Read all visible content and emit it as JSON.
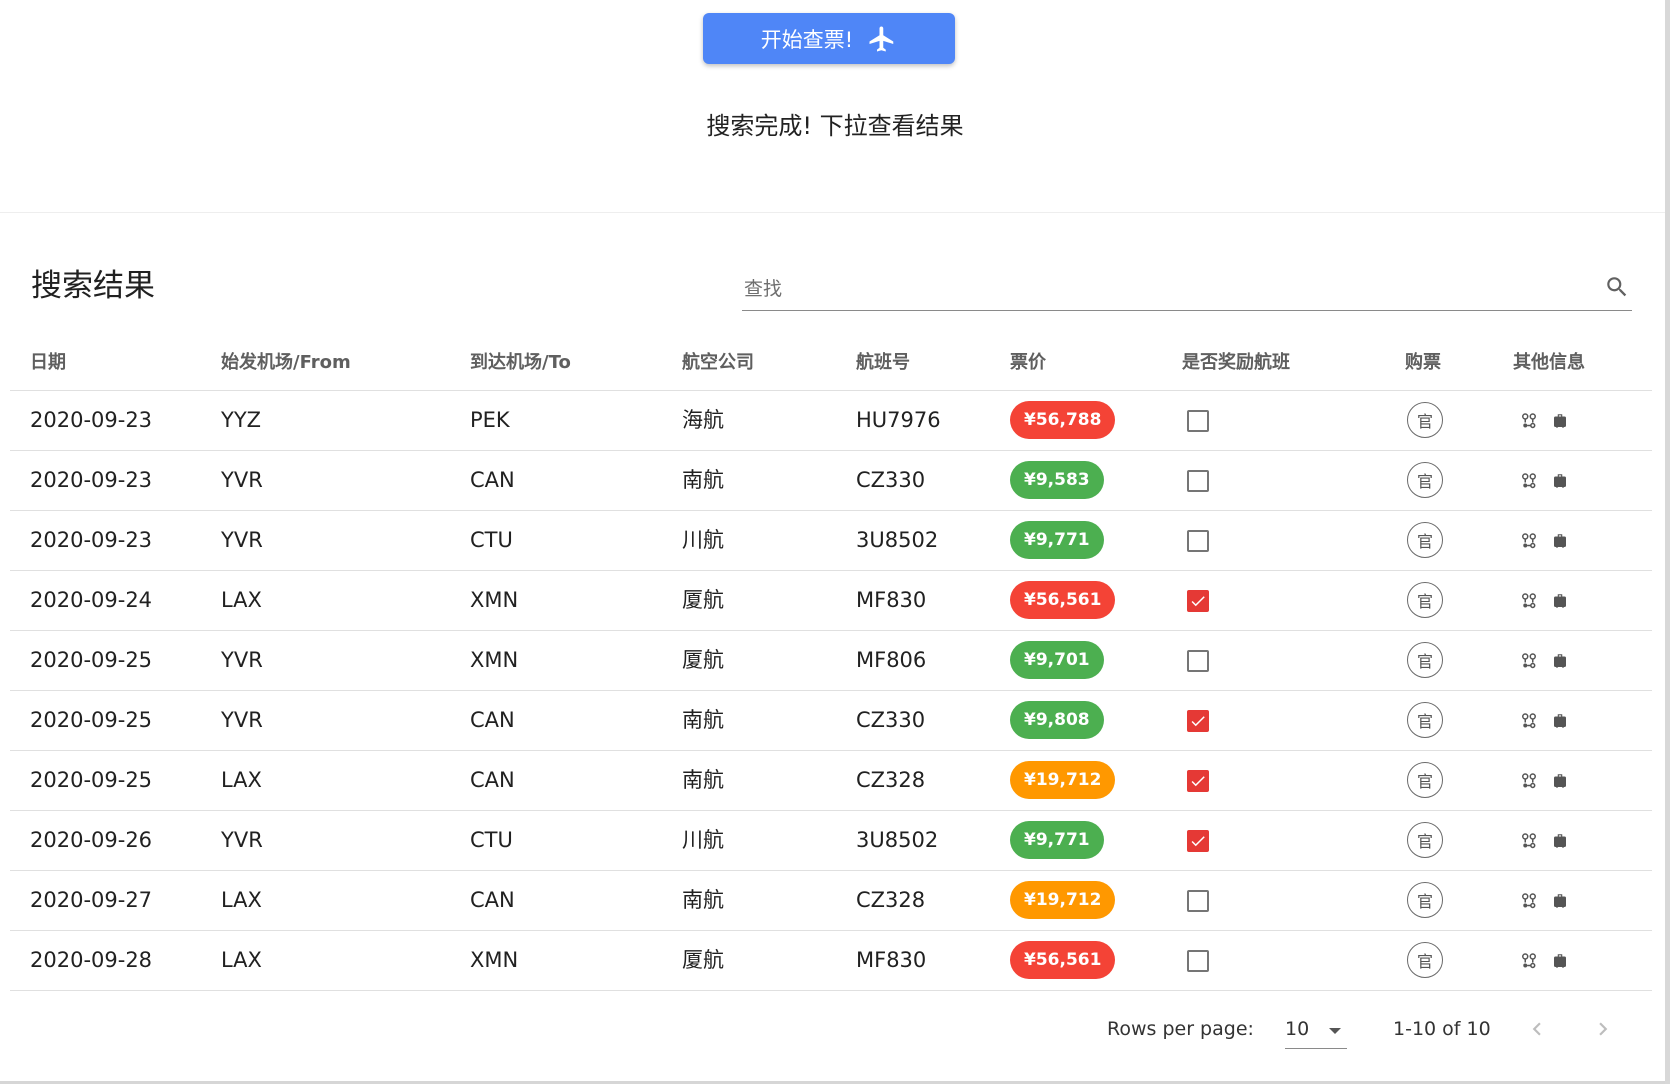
{
  "top": {
    "start_button_label": "开始查票!",
    "status_message": "搜索完成! 下拉查看结果"
  },
  "results": {
    "title": "搜索结果",
    "search_placeholder": "查找"
  },
  "columns": [
    "日期",
    "始发机场/From",
    "到达机场/To",
    "航空公司",
    "航班号",
    "票价",
    "是否奖励航班",
    "购票",
    "其他信息"
  ],
  "rows": [
    {
      "date": "2020-09-23",
      "from": "YYZ",
      "to": "PEK",
      "airline": "海航",
      "flight": "HU7976",
      "price": "¥56,788",
      "price_level": "high",
      "reward": false,
      "buy_label": "官"
    },
    {
      "date": "2020-09-23",
      "from": "YVR",
      "to": "CAN",
      "airline": "南航",
      "flight": "CZ330",
      "price": "¥9,583",
      "price_level": "low",
      "reward": false,
      "buy_label": "官"
    },
    {
      "date": "2020-09-23",
      "from": "YVR",
      "to": "CTU",
      "airline": "川航",
      "flight": "3U8502",
      "price": "¥9,771",
      "price_level": "low",
      "reward": false,
      "buy_label": "官"
    },
    {
      "date": "2020-09-24",
      "from": "LAX",
      "to": "XMN",
      "airline": "厦航",
      "flight": "MF830",
      "price": "¥56,561",
      "price_level": "high",
      "reward": true,
      "buy_label": "官"
    },
    {
      "date": "2020-09-25",
      "from": "YVR",
      "to": "XMN",
      "airline": "厦航",
      "flight": "MF806",
      "price": "¥9,701",
      "price_level": "low",
      "reward": false,
      "buy_label": "官"
    },
    {
      "date": "2020-09-25",
      "from": "YVR",
      "to": "CAN",
      "airline": "南航",
      "flight": "CZ330",
      "price": "¥9,808",
      "price_level": "low",
      "reward": true,
      "buy_label": "官"
    },
    {
      "date": "2020-09-25",
      "from": "LAX",
      "to": "CAN",
      "airline": "南航",
      "flight": "CZ328",
      "price": "¥19,712",
      "price_level": "mid",
      "reward": true,
      "buy_label": "官"
    },
    {
      "date": "2020-09-26",
      "from": "YVR",
      "to": "CTU",
      "airline": "川航",
      "flight": "3U8502",
      "price": "¥9,771",
      "price_level": "low",
      "reward": true,
      "buy_label": "官"
    },
    {
      "date": "2020-09-27",
      "from": "LAX",
      "to": "CAN",
      "airline": "南航",
      "flight": "CZ328",
      "price": "¥19,712",
      "price_level": "mid",
      "reward": false,
      "buy_label": "官"
    },
    {
      "date": "2020-09-28",
      "from": "LAX",
      "to": "XMN",
      "airline": "厦航",
      "flight": "MF830",
      "price": "¥56,561",
      "price_level": "high",
      "reward": false,
      "buy_label": "官"
    }
  ],
  "price_colors": {
    "high": "#f44336",
    "mid": "#ff9800",
    "low": "#4caf50"
  },
  "icons": {
    "start_button": "airplane-icon",
    "search": "search-icon",
    "info": [
      "route-pins-icon",
      "luggage-icon"
    ],
    "prev": "chevron-left-icon",
    "next": "chevron-right-icon",
    "dropdown": "caret-down-icon"
  },
  "pagination": {
    "rows_per_page_label": "Rows per page:",
    "rows_per_page_value": "10",
    "range_text": "1-10 of 10"
  },
  "colors": {
    "accent": "#4f86f7",
    "reward_checked": "#e53935"
  }
}
